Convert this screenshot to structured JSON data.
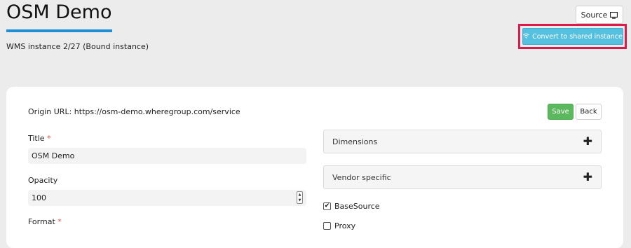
{
  "header": {
    "title": "OSM Demo",
    "subtitle": "WMS instance 2/27 (Bound instance)",
    "source_button_label": "Source",
    "source_button_icon": "monitor-icon",
    "convert_button_label": "Convert to shared instance",
    "convert_button_icon": "wifi-icon"
  },
  "form": {
    "origin_label": "Origin URL:",
    "origin_value": "https://osm-demo.wheregroup.com/service",
    "save_label": "Save",
    "back_label": "Back",
    "title_label": "Title",
    "title_required": "*",
    "title_value": "OSM Demo",
    "opacity_label": "Opacity",
    "opacity_value": "100",
    "format_label": "Format",
    "format_required": "*"
  },
  "panels": [
    {
      "label": "Dimensions"
    },
    {
      "label": "Vendor specific"
    }
  ],
  "checkboxes": [
    {
      "label": "BaseSource",
      "checked": true
    },
    {
      "label": "Proxy",
      "checked": false
    }
  ],
  "colors": {
    "accent_underline": "#1e90d8",
    "convert_button": "#56c0e0",
    "save_button": "#5cb85c",
    "highlight": "#e0194a",
    "required": "#d9534f"
  }
}
